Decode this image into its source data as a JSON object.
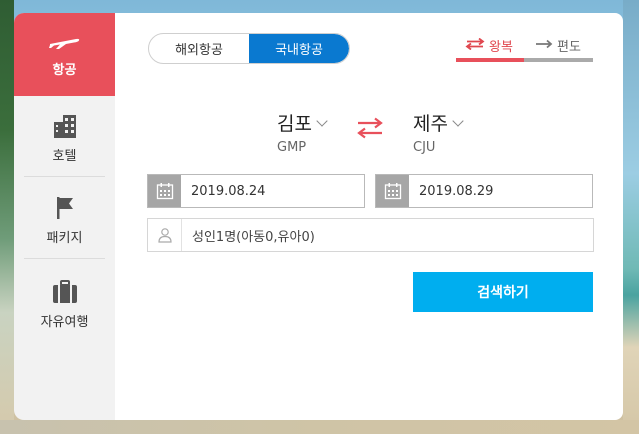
{
  "nav": {
    "items": [
      {
        "label": "항공",
        "icon": "airplane-icon",
        "active": true
      },
      {
        "label": "호텔",
        "icon": "hotel-icon"
      },
      {
        "label": "패키지",
        "icon": "flag-icon"
      },
      {
        "label": "자유여행",
        "icon": "suitcase-icon"
      }
    ]
  },
  "tabs": {
    "international": "해외항공",
    "domestic": "국내항공",
    "selected": "domestic"
  },
  "trip_type": {
    "round_trip": "왕복",
    "one_way": "편도",
    "selected": "round_trip"
  },
  "route": {
    "origin": {
      "name": "김포",
      "code": "GMP"
    },
    "destination": {
      "name": "제주",
      "code": "CJU"
    }
  },
  "dates": {
    "departure": "2019.08.24",
    "return": "2019.08.29"
  },
  "passengers": {
    "value": "성인1명(아동0,유아0)"
  },
  "search_button": "검색하기",
  "colors": {
    "accent_red": "#e8505b",
    "tab_blue": "#0a79d0",
    "search_blue": "#00aeef"
  }
}
